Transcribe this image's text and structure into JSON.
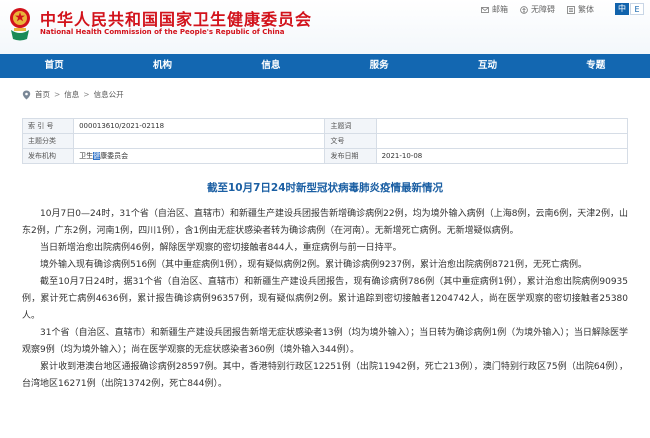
{
  "header": {
    "site_title": "中华人民共和国国家卫生健康委员会",
    "site_subtitle": "National Health Commission of the People's Republic of China",
    "top_links": [
      {
        "label": "邮箱",
        "icon": "mail-icon"
      },
      {
        "label": "无障碍",
        "icon": "accessibility-icon"
      },
      {
        "label": "繁体",
        "icon": "traditional-chinese-icon"
      }
    ],
    "lang_zh": "中",
    "lang_en": "E"
  },
  "nav": {
    "items": [
      "首页",
      "机构",
      "信息",
      "服务",
      "互动",
      "专题"
    ]
  },
  "breadcrumb": {
    "items": [
      "首页",
      "信息",
      "信息公开"
    ],
    "sep": ">"
  },
  "meta": {
    "index_label": "索 引 号",
    "index_value": "000013610/2021-02118",
    "subject_label": "主题词",
    "subject_value": "",
    "category_label": "主题分类",
    "category_value": "",
    "docno_label": "文号",
    "docno_value": "",
    "issuer_label": "发布机构",
    "issuer_value_a": "卫生",
    "issuer_value_b": "健",
    "issuer_value_c": "康委员会",
    "date_label": "发布日期",
    "date_value": "2021-10-08"
  },
  "article": {
    "title": "截至10月7日24时新型冠状病毒肺炎疫情最新情况",
    "paragraphs": [
      "10月7日0—24时，31个省（自治区、直辖市）和新疆生产建设兵团报告新增确诊病例22例，均为境外输入病例（上海8例，云南6例，天津2例，山东2例，广东2例，河南1例，四川1例），含1例由无症状感染者转为确诊病例（在河南）。无新增死亡病例。无新增疑似病例。",
      "当日新增治愈出院病例46例，解除医学观察的密切接触者844人，重症病例与前一日持平。",
      "境外输入现有确诊病例516例（其中重症病例1例），现有疑似病例2例。累计确诊病例9237例，累计治愈出院病例8721例，无死亡病例。",
      "截至10月7日24时，据31个省（自治区、直辖市）和新疆生产建设兵团报告，现有确诊病例786例（其中重症病例1例），累计治愈出院病例90935例，累计死亡病例4636例，累计报告确诊病例96357例，现有疑似病例2例。累计追踪到密切接触者1204742人，尚在医学观察的密切接触者25380人。",
      "31个省（自治区、直辖市）和新疆生产建设兵团报告新增无症状感染者13例（均为境外输入）；当日转为确诊病例1例（为境外输入）；当日解除医学观察9例（均为境外输入）；尚在医学观察的无症状感染者360例（境外输入344例）。",
      "累计收到港澳台地区通报确诊病例28597例。其中，香港特别行政区12251例（出院11942例，死亡213例），澳门特别行政区75例（出院64例），台湾地区16271例（出院13742例，死亡844例）。"
    ]
  },
  "colors": {
    "brand_red": "#d2121b",
    "nav_blue": "#1367b1",
    "title_blue": "#1b5fa3"
  }
}
